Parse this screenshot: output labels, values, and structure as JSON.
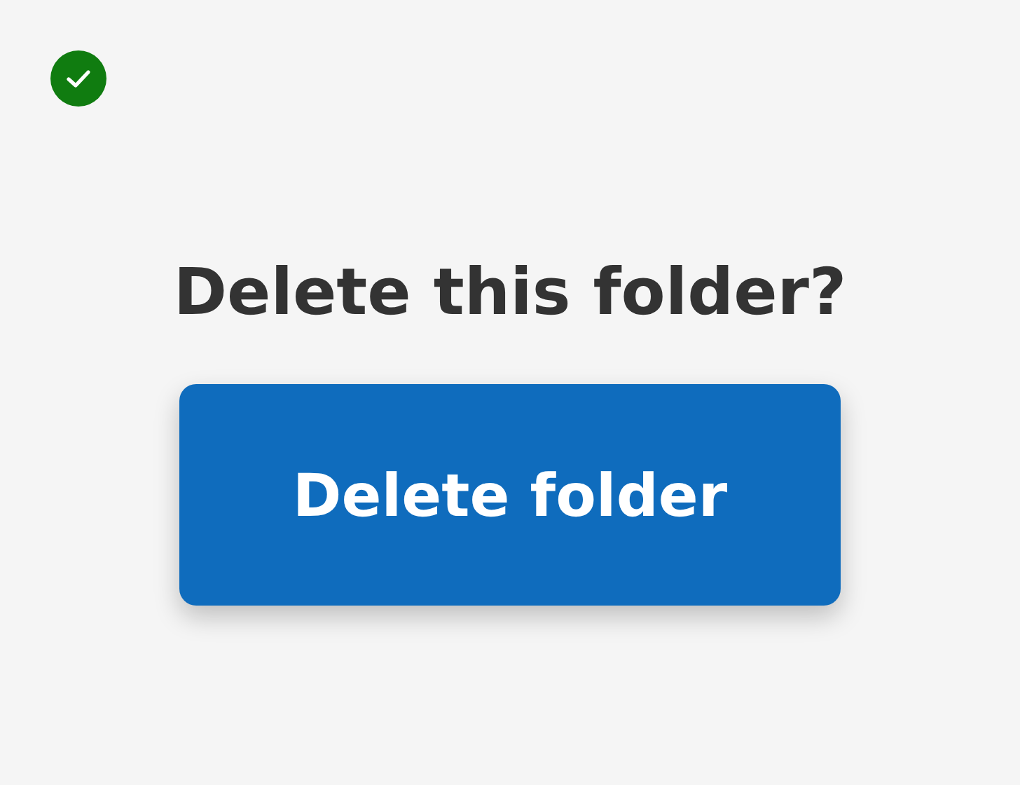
{
  "title": "Delete this folder?",
  "button": {
    "label": "Delete folder"
  }
}
